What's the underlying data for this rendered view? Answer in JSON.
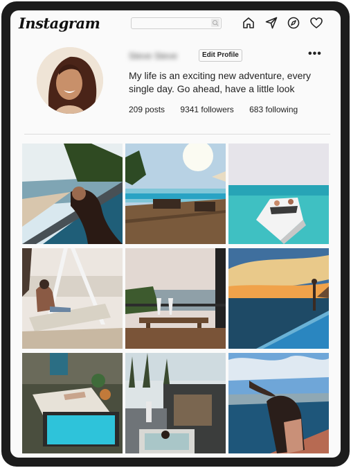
{
  "app": {
    "logo_text": "Instagram"
  },
  "search": {
    "value": "",
    "placeholder": ""
  },
  "nav": [
    {
      "name": "home-icon"
    },
    {
      "name": "send-icon"
    },
    {
      "name": "explore-icon"
    },
    {
      "name": "heart-icon"
    }
  ],
  "profile": {
    "username": "Steve Steve",
    "edit_label": "Edit Profile",
    "more_label": "•••",
    "bio": "My life is an exciting new adventure, every single day. Go ahead, have a little look",
    "posts": "209 posts",
    "followers": "9341 followers",
    "following": "683 following"
  },
  "posts": [
    {
      "subject": "beach-pool-woman"
    },
    {
      "subject": "deck-loungers-sunset"
    },
    {
      "subject": "boat-turquoise-sea"
    },
    {
      "subject": "woman-on-swing"
    },
    {
      "subject": "balcony-table-wine"
    },
    {
      "subject": "infinity-pool-sunset"
    },
    {
      "subject": "courtyard-pool"
    },
    {
      "subject": "woman-in-hot-tub"
    },
    {
      "subject": "woman-cliff-sea"
    }
  ],
  "colors": {
    "text": "#222222",
    "border": "#c9c9c9",
    "frame": "#1c1c1c"
  }
}
